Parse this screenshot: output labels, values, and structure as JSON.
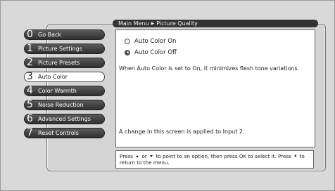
{
  "breadcrumb": {
    "root": "Main Menu",
    "current": "Picture Quality"
  },
  "menu": [
    {
      "num": "0",
      "label": "Go Back"
    },
    {
      "num": "1",
      "label": "Picture Settings"
    },
    {
      "num": "2",
      "label": "Picture Presets"
    },
    {
      "num": "3",
      "label": "Auto Color",
      "active": true
    },
    {
      "num": "4",
      "label": "Color Warmth"
    },
    {
      "num": "5",
      "label": "Noise Reduction"
    },
    {
      "num": "6",
      "label": "Advanced Settings"
    },
    {
      "num": "7",
      "label": "Reset Controls"
    }
  ],
  "options": [
    {
      "label": "Auto Color On",
      "selected": false
    },
    {
      "label": "Auto Color Off",
      "selected": true
    }
  ],
  "description": "When Auto Color is set to On, it minimizes flesh tone variations.",
  "note": "A change in this screen is applied to Input 2.",
  "help": {
    "press": "Press",
    "or": "or",
    "point": "to point to an option, then press OK to select it. Press",
    "return": "to return to the menu."
  }
}
